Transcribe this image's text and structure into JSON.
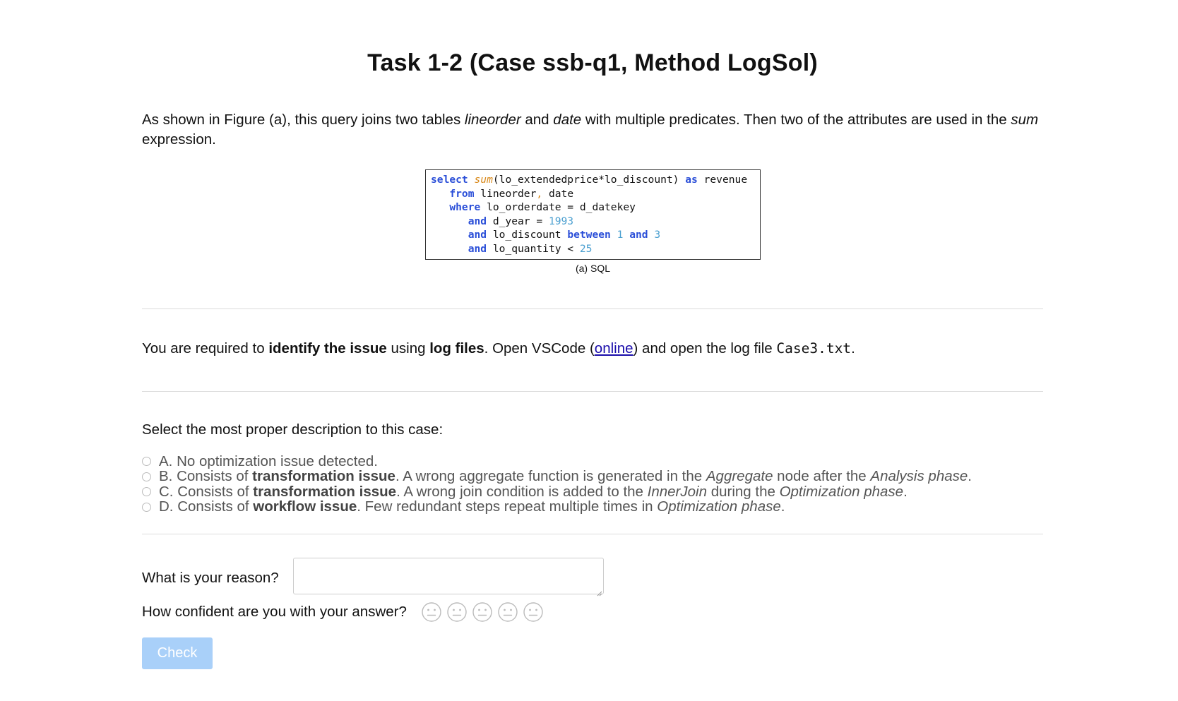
{
  "title": "Task 1-2 (Case ssb-q1, Method LogSol)",
  "intro": {
    "part1": "As shown in Figure (a), this query joins two tables ",
    "table1": "lineorder",
    "part2": " and ",
    "table2": "date",
    "part3": " with multiple predicates. Then two of the attributes are used in the ",
    "expr": "sum",
    "part4": " expression."
  },
  "figure": {
    "caption": "(a) SQL",
    "sql_lines": [
      [
        {
          "t": "select",
          "c": "kw"
        },
        {
          "t": " "
        },
        {
          "t": "sum",
          "c": "fn"
        },
        {
          "t": "(lo_extendedprice*lo_discount) "
        },
        {
          "t": "as",
          "c": "kw"
        },
        {
          "t": " revenue"
        }
      ],
      [
        {
          "t": "   "
        },
        {
          "t": "from",
          "c": "kw"
        },
        {
          "t": " lineorder"
        },
        {
          "t": ",",
          "c": "punc"
        },
        {
          "t": " date"
        }
      ],
      [
        {
          "t": "   "
        },
        {
          "t": "where",
          "c": "kw"
        },
        {
          "t": " lo_orderdate = d_datekey"
        }
      ],
      [
        {
          "t": "      "
        },
        {
          "t": "and",
          "c": "kw"
        },
        {
          "t": " d_year = "
        },
        {
          "t": "1993",
          "c": "num"
        }
      ],
      [
        {
          "t": "      "
        },
        {
          "t": "and",
          "c": "kw"
        },
        {
          "t": " lo_discount "
        },
        {
          "t": "between",
          "c": "kw"
        },
        {
          "t": " "
        },
        {
          "t": "1",
          "c": "num"
        },
        {
          "t": " "
        },
        {
          "t": "and",
          "c": "kw"
        },
        {
          "t": " "
        },
        {
          "t": "3",
          "c": "num"
        }
      ],
      [
        {
          "t": "      "
        },
        {
          "t": "and",
          "c": "kw"
        },
        {
          "t": " lo_quantity < "
        },
        {
          "t": "25",
          "c": "num"
        }
      ]
    ]
  },
  "instruction": {
    "part1": "You are required to ",
    "bold1": "identify the issue",
    "part2": " using ",
    "bold2": "log files",
    "part3": ". Open VSCode (",
    "link": "online",
    "part4": ") and open the log file ",
    "file": "Case3.txt",
    "part5": "."
  },
  "question": "Select the most proper description to this case:",
  "options": [
    {
      "prefix": "A. No optimization issue detected.",
      "bold": "",
      "mid": "",
      "ital1": "",
      "mid2": "",
      "ital2": "",
      "end": ""
    },
    {
      "prefix": "B. Consists of ",
      "bold": "transformation issue",
      "mid": ". A wrong aggregate function is generated in the ",
      "ital1": "Aggregate",
      "mid2": " node after the ",
      "ital2": "Analysis phase",
      "end": "."
    },
    {
      "prefix": "C. Consists of ",
      "bold": "transformation issue",
      "mid": ". A wrong join condition is added to the ",
      "ital1": "InnerJoin",
      "mid2": " during the ",
      "ital2": "Optimization phase",
      "end": "."
    },
    {
      "prefix": "D. Consists of ",
      "bold": "workflow issue",
      "mid": ". Few redundant steps repeat multiple times in ",
      "ital1": "Optimization phase",
      "mid2": "",
      "ital2": "",
      "end": "."
    }
  ],
  "reason_label": "What is your reason?",
  "reason_value": "",
  "confidence_label": "How confident are you with your answer?",
  "confidence_levels": 5,
  "check_label": "Check",
  "colors": {
    "keyword": "#2b4fd8",
    "function": "#d98a1c",
    "number": "#4a9fd0",
    "button_bg": "#a9d0f9",
    "link": "#1a0dab"
  }
}
